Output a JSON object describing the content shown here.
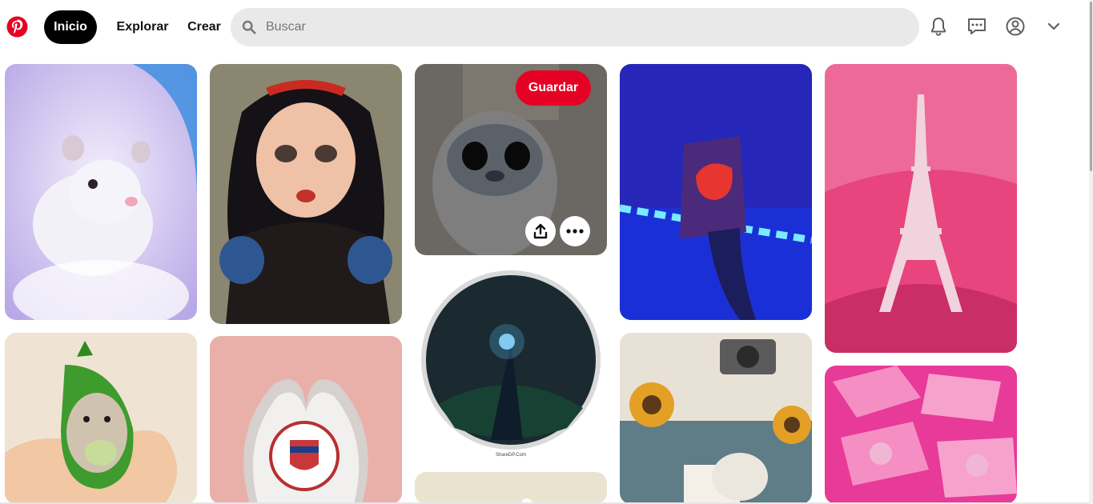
{
  "header": {
    "nav": {
      "home_label": "Inicio",
      "explore_label": "Explorar",
      "create_label": "Crear"
    },
    "search": {
      "placeholder": "Buscar",
      "value": ""
    },
    "icons": [
      "pinterest-logo-icon",
      "bell-icon",
      "chat-icon",
      "account-icon",
      "chevron-down-icon"
    ],
    "brand_color": "#e60023"
  },
  "pins": {
    "hovered": {
      "save_label": "Guardar",
      "actions": [
        "share-icon",
        "more-options-icon"
      ]
    },
    "items": [
      "hamster-snow-photo",
      "princess-illustration-photo",
      "stitch-plush-photo",
      "blue-neon-snack-photo",
      "pink-eiffel-tower-photo",
      "hamster-pea-pod-photo",
      "heart-hands-badge-photo",
      "glowing-hand-circle-photo",
      "cozy-sunflowers-camera-photo",
      "pink-money-photo",
      "beige-partial-photo"
    ],
    "glowing_hand_caption": "ShareDP.Com"
  }
}
